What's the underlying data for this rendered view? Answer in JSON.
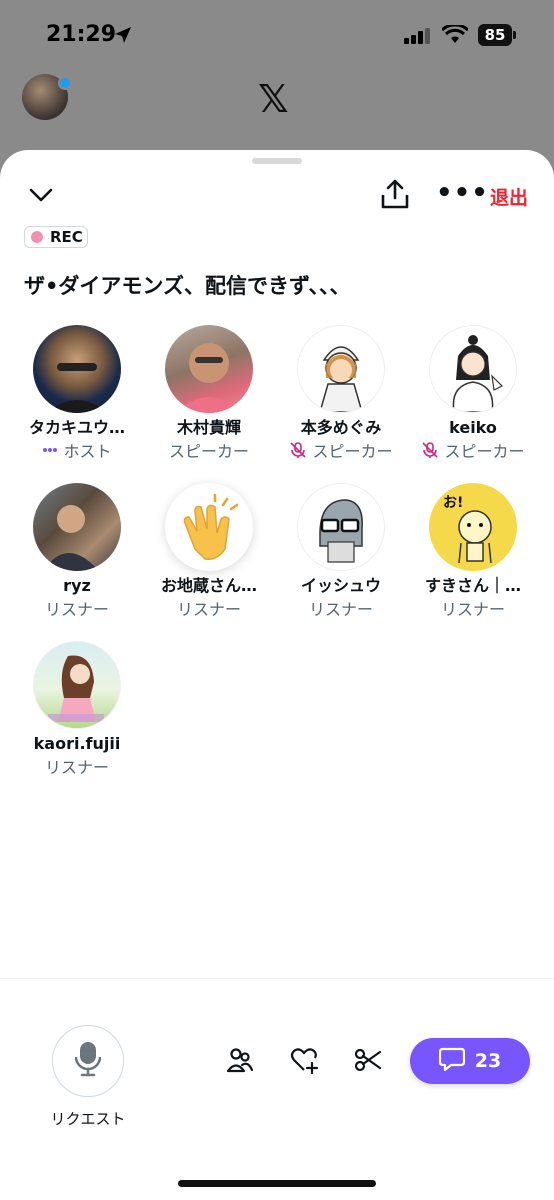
{
  "status_bar": {
    "time": "21:29",
    "battery": "85"
  },
  "app": {
    "logo": "𝕏"
  },
  "header": {
    "leave_label": "退出"
  },
  "recording": {
    "label": "REC",
    "dot_color": "#f48fb1"
  },
  "space": {
    "title": "ザ•ダイアモンズ、配信できず、、、"
  },
  "participants": [
    {
      "name": "タカキユウ…",
      "role": "ホスト",
      "role_icon": "host-dots-icon"
    },
    {
      "name": "木村貴輝",
      "role": "スピーカー",
      "role_icon": "none"
    },
    {
      "name": "本多めぐみ",
      "role": "スピーカー",
      "role_icon": "mic-muted-icon"
    },
    {
      "name": "keiko",
      "role": "スピーカー",
      "role_icon": "mic-muted-icon"
    },
    {
      "name": "ryz",
      "role": "リスナー",
      "role_icon": "none"
    },
    {
      "name": "お地蔵さん…",
      "role": "リスナー",
      "role_icon": "none"
    },
    {
      "name": "イッシュウ",
      "role": "リスナー",
      "role_icon": "none"
    },
    {
      "name": "すきさん｜…",
      "role": "リスナー",
      "role_icon": "none"
    },
    {
      "name": "kaori.fujii",
      "role": "リスナー",
      "role_icon": "none"
    }
  ],
  "bottom_bar": {
    "request_label": "リクエスト",
    "chat_count": "23",
    "chat_color": "#7856ff"
  }
}
